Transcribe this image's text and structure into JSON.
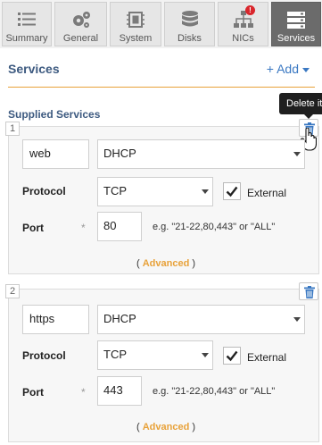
{
  "tabs": [
    {
      "label": "Summary",
      "icon": "list-icon",
      "active": false,
      "alert": ""
    },
    {
      "label": "General",
      "icon": "gears-icon",
      "active": false,
      "alert": ""
    },
    {
      "label": "System",
      "icon": "chip-icon",
      "active": false,
      "alert": ""
    },
    {
      "label": "Disks",
      "icon": "database-icon",
      "active": false,
      "alert": ""
    },
    {
      "label": "NICs",
      "icon": "network-icon",
      "active": false,
      "alert": "!"
    },
    {
      "label": "Services",
      "icon": "server-icon",
      "active": true,
      "alert": ""
    }
  ],
  "header": {
    "title": "Services",
    "add_label": "+ Add"
  },
  "supplied_title": "Supplied Services",
  "tooltip": "Delete item",
  "services": [
    {
      "index": "1",
      "name": "web",
      "type": "DHCP",
      "protocol_label": "Protocol",
      "protocol": "TCP",
      "external_checked": true,
      "external_label": "External",
      "port_label": "Port",
      "port_required": "*",
      "port": "80",
      "port_hint": "e.g. \"21-22,80,443\" or \"ALL\"",
      "advanced_open": "(",
      "advanced_label": "Advanced",
      "advanced_close": ")"
    },
    {
      "index": "2",
      "name": "https",
      "type": "DHCP",
      "protocol_label": "Protocol",
      "protocol": "TCP",
      "external_checked": true,
      "external_label": "External",
      "port_label": "Port",
      "port_required": "*",
      "port": "443",
      "port_hint": "e.g. \"21-22,80,443\" or \"ALL\"",
      "advanced_open": "(",
      "advanced_label": "Advanced",
      "advanced_close": ")"
    }
  ],
  "colors": {
    "accent_orange": "#e8a23a",
    "heading_blue": "#3d5a80",
    "link_blue": "#3a78c2",
    "active_tab": "#6b6b6b",
    "alert_red": "#d9262c"
  }
}
